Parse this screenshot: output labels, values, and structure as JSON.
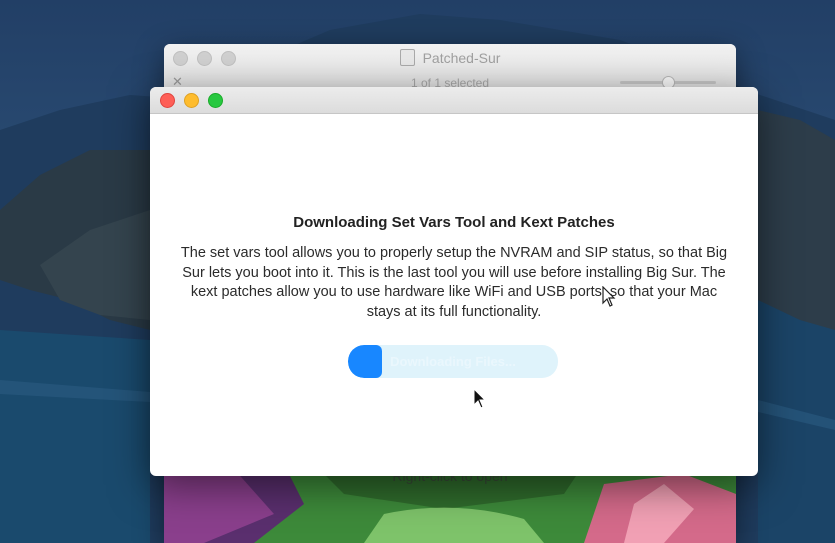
{
  "finder_window": {
    "title": "Patched-Sur",
    "status": "1 of 1 selected",
    "background_hint": "Right-click to open"
  },
  "dialog": {
    "heading": "Downloading Set Vars Tool and Kext Patches",
    "body": "The set vars tool allows you to properly setup the NVRAM and SIP status, so that Big Sur lets you boot into it. This is the last tool you will use before installing Big Sur. The kext patches allow you to use hardware like WiFi and USB ports, so that your Mac stays at its full functionality.",
    "progress": {
      "label": "Downloading Files...",
      "fraction": 0.16,
      "fill_color": "#1887ff",
      "track_color": "#dff3fb"
    }
  },
  "colors": {
    "close": "#fe5f57",
    "minimize": "#febc2e",
    "zoom": "#28c840"
  }
}
